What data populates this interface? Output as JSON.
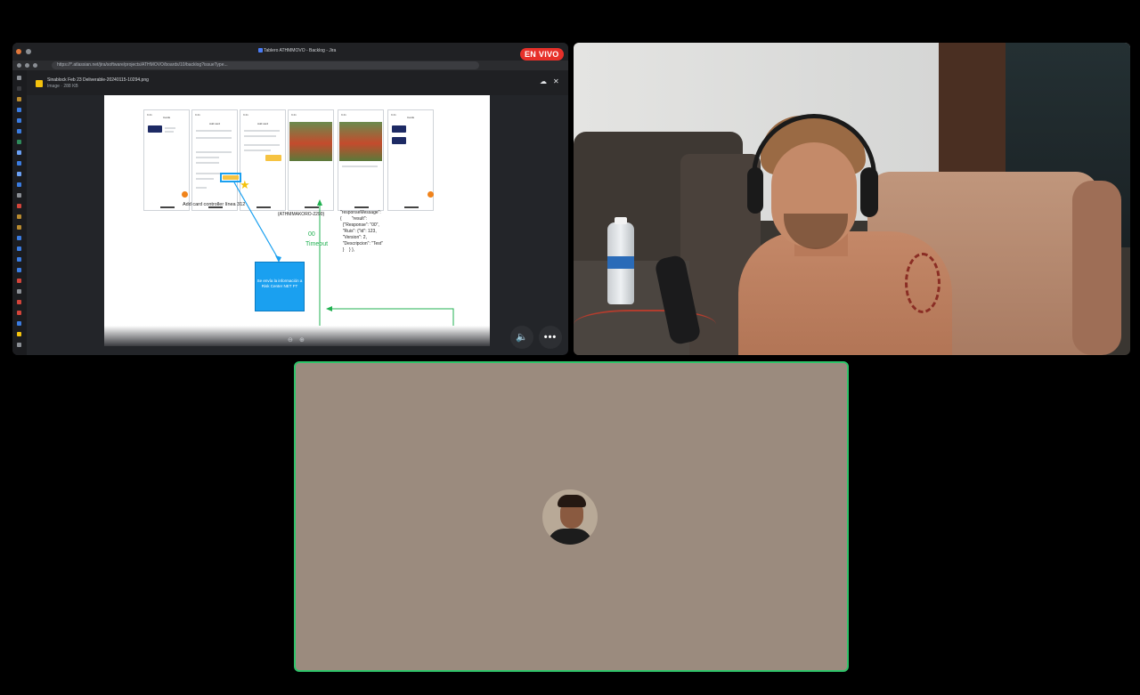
{
  "live_badge": "EN VIVO",
  "browser": {
    "tab_title": "Tablero ATHMMOVO - Backlog - Jira",
    "url": "https://*.atlassian.net/jira/software/projects/ATHMOVO/boards/10/backlog?issueType..."
  },
  "viewer": {
    "file_name": "Sinablock Feb 23 Deliverable-20240115-10294.png",
    "file_meta": "Image · 288 KB",
    "cloud_icon": "cloud-download-icon",
    "close_icon": "close-icon",
    "zoom_out": "⊖",
    "zoom_in": "⊕"
  },
  "diagram": {
    "screen_titles": [
      "Cards",
      "Add card",
      "Add card",
      "",
      "",
      "Cards"
    ],
    "caption_left": "Add card controller línea 312",
    "ref_code": "{ATHMMAKORO-2290}",
    "timeout_code": "00",
    "timeout_label": "Timeout",
    "response_block": "\"responseMessage\":\n{        \"result\":\n  {\"Response\": \"00\",\n  \"Ruis\": {\"id\": 123,\n  \"Version\": 2,\n  \"Descripcion\": \"Test\"\n  }    } },",
    "blue_box": "Se envía la información a Risk Center NET FT"
  },
  "controls": {
    "speaker_icon": "speaker-icon",
    "more_icon": "more-icon"
  },
  "colors": {
    "live": "#e7302a",
    "active_speaker_border": "#2fc46a",
    "avatar_tile_bg": "#9b8b7e"
  }
}
